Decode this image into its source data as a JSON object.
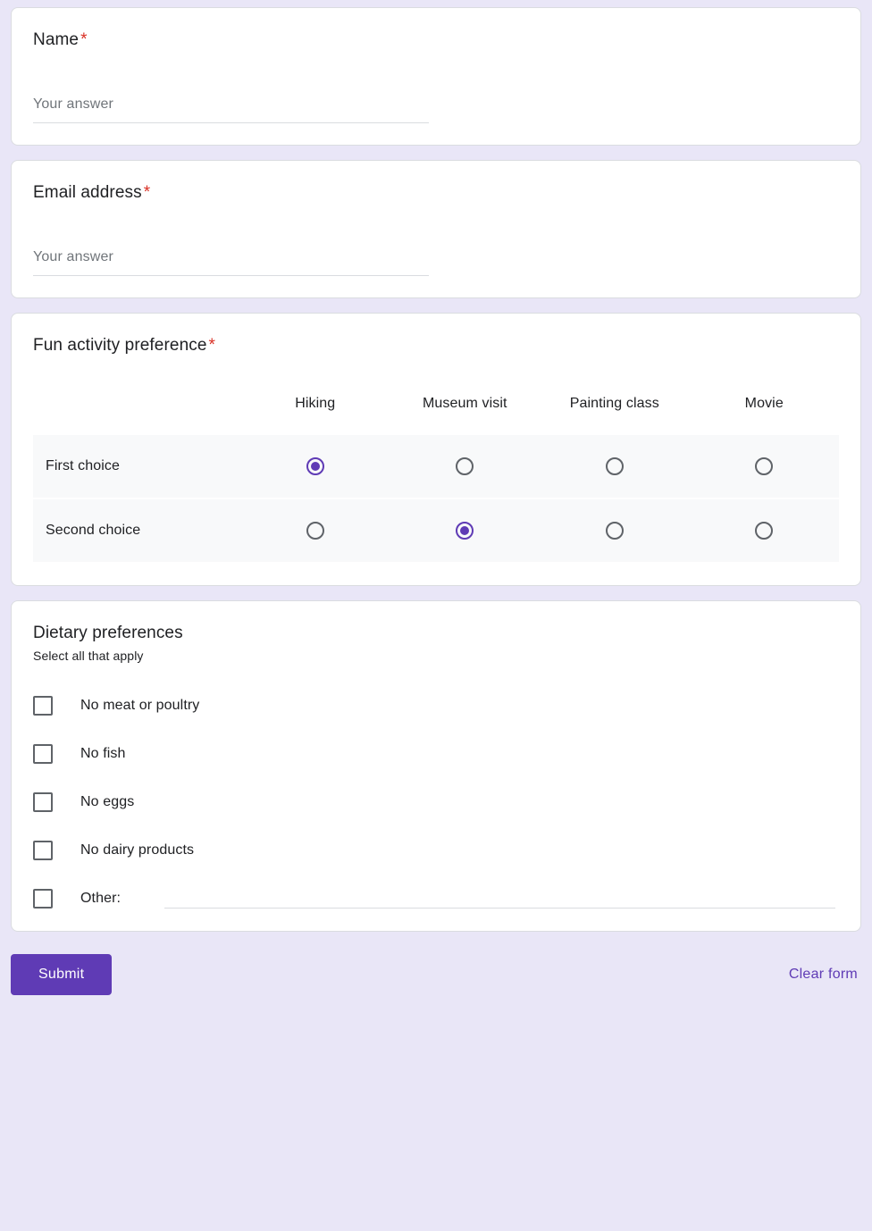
{
  "theme": {
    "page_background": "#e9e6f7",
    "card_background": "#ffffff",
    "accent": "#5f3bb5",
    "required_star_color": "#d93025",
    "grid_row_background": "#f8f9fa",
    "text_primary": "#202124",
    "placeholder_color": "#70757a"
  },
  "questions": [
    {
      "id": "name",
      "title": "Name",
      "required_marker": "*",
      "answer_placeholder": "Your answer"
    },
    {
      "id": "email",
      "title": "Email address",
      "required_marker": "*",
      "answer_placeholder": "Your answer"
    }
  ],
  "grid_question": {
    "title": "Fun activity preference",
    "required_marker": "*",
    "columns": [
      "Hiking",
      "Museum visit",
      "Painting class",
      "Movie"
    ],
    "rows": [
      {
        "label": "First choice",
        "selected_column": "Hiking"
      },
      {
        "label": "Second choice",
        "selected_column": "Museum visit"
      }
    ]
  },
  "checkbox_question": {
    "title": "Dietary preferences",
    "help_text": "Select all that apply",
    "options": [
      {
        "label": "No meat or poultry",
        "checked": false
      },
      {
        "label": "No fish",
        "checked": false
      },
      {
        "label": "No eggs",
        "checked": false
      },
      {
        "label": "No dairy products",
        "checked": false
      }
    ],
    "other_option": {
      "label": "Other:",
      "checked": false,
      "value": ""
    }
  },
  "footer": {
    "submit_label": "Submit",
    "clear_label": "Clear form"
  }
}
